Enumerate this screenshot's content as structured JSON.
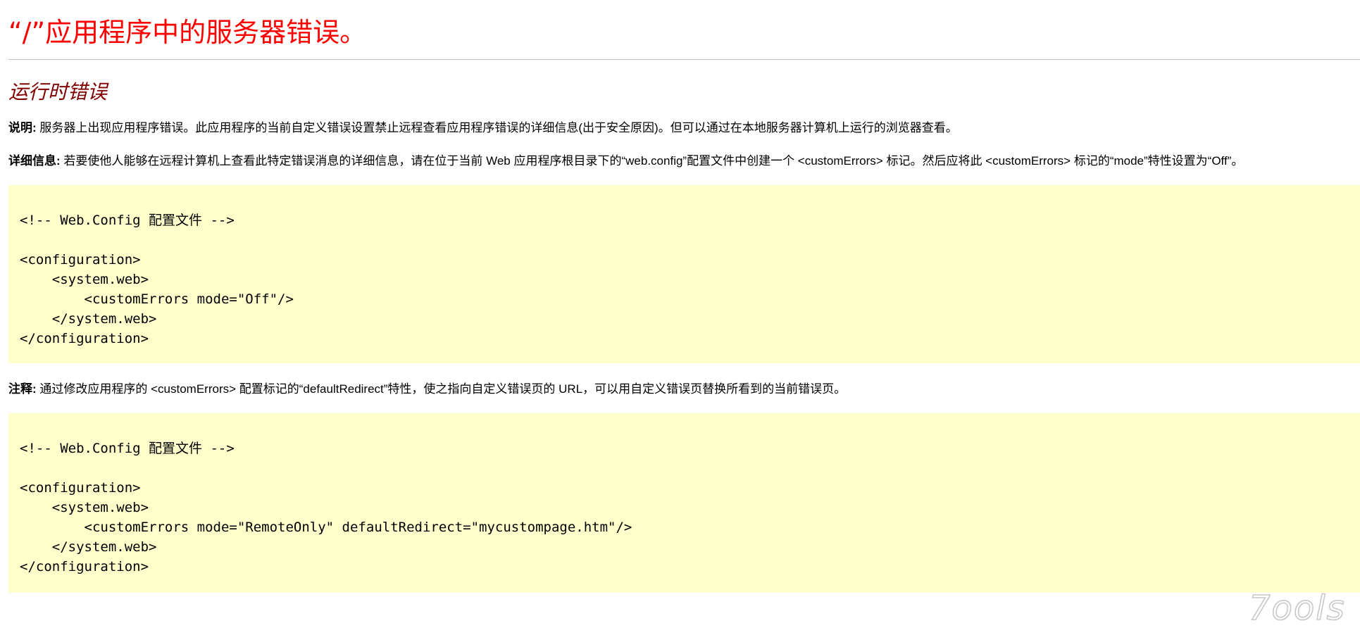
{
  "header": {
    "title": "“/”应用程序中的服务器错误。"
  },
  "error": {
    "heading": "运行时错误",
    "description_label": "说明:",
    "description_text": " 服务器上出现应用程序错误。此应用程序的当前自定义错误设置禁止远程查看应用程序错误的详细信息(出于安全原因)。但可以通过在本地服务器计算机上运行的浏览器查看。",
    "details_label": "详细信息:",
    "details_text": " 若要使他人能够在远程计算机上查看此特定错误消息的详细信息，请在位于当前 Web 应用程序根目录下的“web.config”配置文件中创建一个 <customErrors> 标记。然后应将此 <customErrors> 标记的“mode”特性设置为“Off”。",
    "notes_label": "注释:",
    "notes_text": " 通过修改应用程序的 <customErrors> 配置标记的“defaultRedirect”特性，使之指向自定义错误页的 URL，可以用自定义错误页替换所看到的当前错误页。"
  },
  "code_block_1": {
    "comment_start": "<!-- Web.Config ",
    "comment_cn": "配置文件",
    "comment_end": " -->",
    "lines": [
      "",
      "<configuration>",
      "    <system.web>",
      "        <customErrors mode=\"Off\"/>",
      "    </system.web>",
      "</configuration>"
    ]
  },
  "code_block_2": {
    "comment_start": "<!-- Web.Config ",
    "comment_cn": "配置文件",
    "comment_end": " -->",
    "lines": [
      "",
      "<configuration>",
      "    <system.web>",
      "        <customErrors mode=\"RemoteOnly\" defaultRedirect=\"mycustompage.htm\"/>",
      "    </system.web>",
      "</configuration>"
    ]
  },
  "watermark": {
    "text": "7ools"
  },
  "colors": {
    "title": "#ff0000",
    "heading": "#800000",
    "code_background": "#ffffcc",
    "rule": "#c0c0c0"
  }
}
